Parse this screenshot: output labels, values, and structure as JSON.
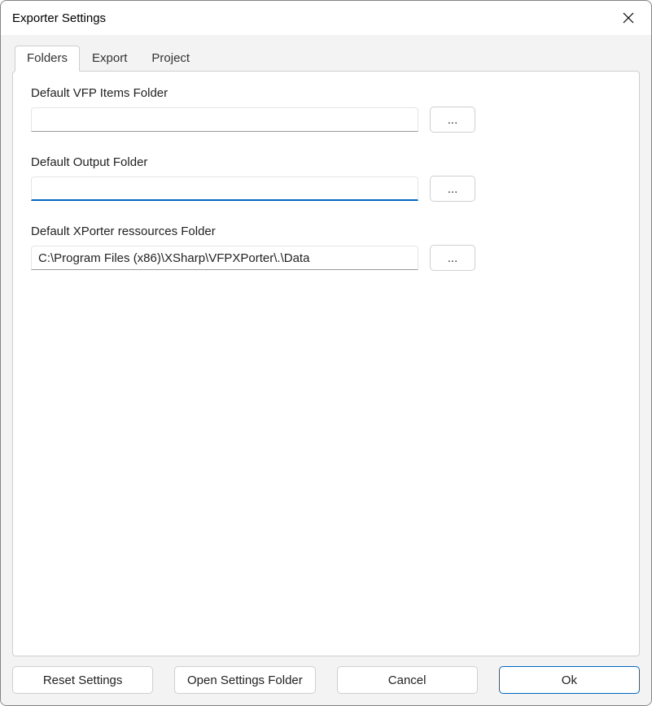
{
  "window": {
    "title": "Exporter Settings"
  },
  "tabs": {
    "folders": "Folders",
    "export": "Export",
    "project": "Project"
  },
  "fields": {
    "vfp_items": {
      "label": "Default VFP Items Folder",
      "value": "",
      "browse": "..."
    },
    "output": {
      "label": "Default Output Folder",
      "value": "",
      "browse": "..."
    },
    "resources": {
      "label": "Default XPorter ressources Folder",
      "value": "C:\\Program Files (x86)\\XSharp\\VFPXPorter\\.\\Data",
      "browse": "..."
    }
  },
  "buttons": {
    "reset": "Reset Settings",
    "open_folder": "Open Settings Folder",
    "cancel": "Cancel",
    "ok": "Ok"
  }
}
